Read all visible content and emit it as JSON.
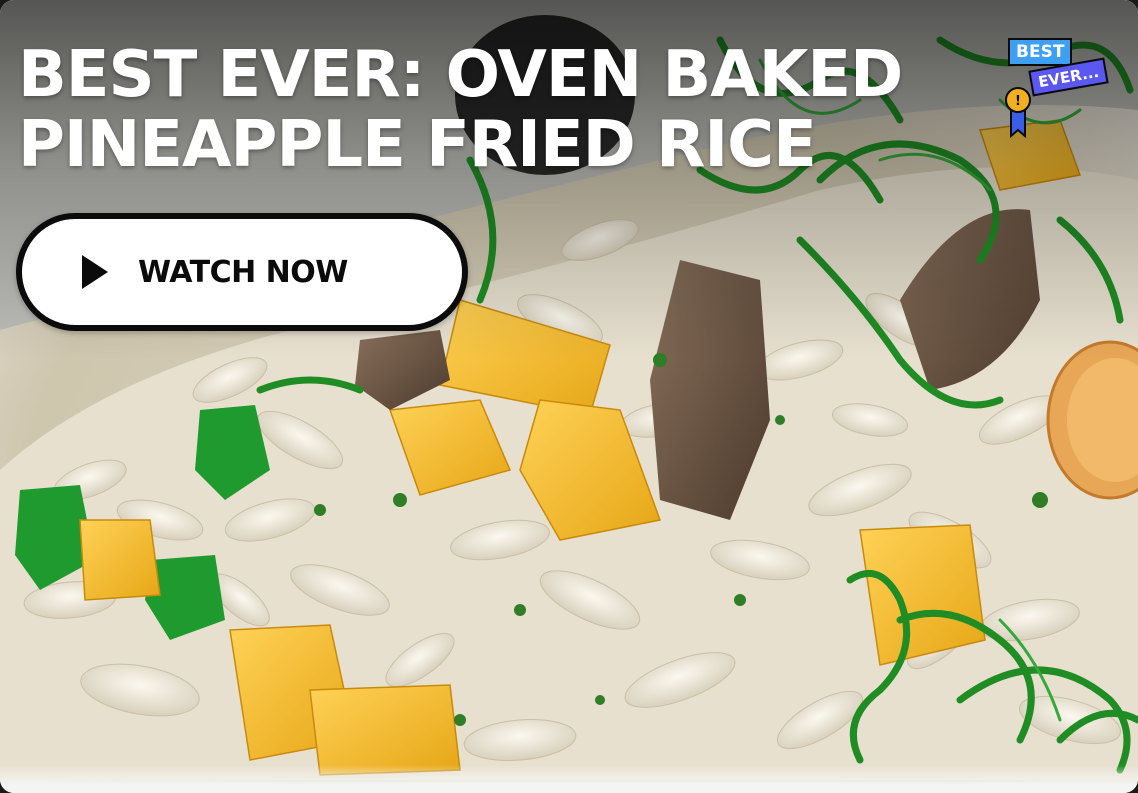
{
  "card": {
    "title_line1": "BEST EVER: OVEN BAKED",
    "title_line2": "PINEAPPLE FRIED RICE",
    "watch_label": "WATCH NOW",
    "badge_line1": "BEST",
    "badge_line2": "EVER...",
    "badge_medal_mark": "!"
  },
  "icons": {
    "play": "play-icon",
    "badge": "best-ever-badge-icon",
    "medal": "medal-icon"
  },
  "colors": {
    "button_bg": "#ffffff",
    "button_border": "#0b0b0b",
    "title": "#ffffff",
    "badge_blue": "#3ea0f3",
    "badge_purple": "#5a58f0",
    "medal_gold": "#f2b01e"
  }
}
